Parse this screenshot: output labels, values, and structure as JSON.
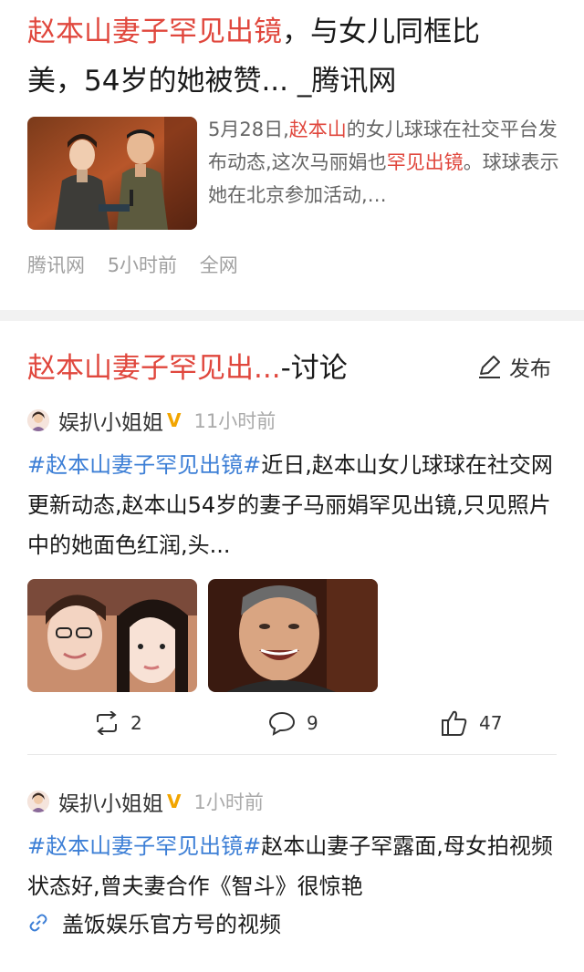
{
  "card1": {
    "title_highlight": "赵本山妻子罕见出镜",
    "title_rest_line1": "，与女儿同框比",
    "title_line2": "美，54岁的她被赞... _腾讯网",
    "snippet": {
      "part1": "5月28日,",
      "hl1": "赵本山",
      "part2": "的女儿球球在社交平台发布动态,这次马丽娟也",
      "hl2": "罕见出镜",
      "part3": "。球球表示她在北京参加活动,…"
    },
    "meta": {
      "source": "腾讯网",
      "time": "5小时前",
      "scope": "全网"
    }
  },
  "card2": {
    "header_highlight": "赵本山妻子罕见出...",
    "header_rest": "-讨论",
    "publish_label": "发布",
    "posts": [
      {
        "user": "娱扒小姐姐",
        "badge": "V",
        "time": "11小时前",
        "tag": "#赵本山妻子罕见出镜#",
        "text": "近日,赵本山女儿球球在社交网更新动态,赵本山54岁的妻子马丽娟罕见出镜,只见照片中的她面色红润,头...",
        "actions": {
          "repost": "2",
          "comment": "9",
          "like": "47"
        }
      },
      {
        "user": "娱扒小姐姐",
        "badge": "V",
        "time": "1小时前",
        "tag": "#赵本山妻子罕见出镜#",
        "text": "赵本山妻子罕露面,母女拍视频状态好,曾夫妻合作《智斗》很惊艳",
        "link_text": "盖饭娱乐官方号的视频"
      }
    ]
  },
  "colors": {
    "highlight": "#e0473d",
    "tag": "#3d7fd6",
    "muted": "#a0a0a0",
    "badge": "#f2a500"
  }
}
